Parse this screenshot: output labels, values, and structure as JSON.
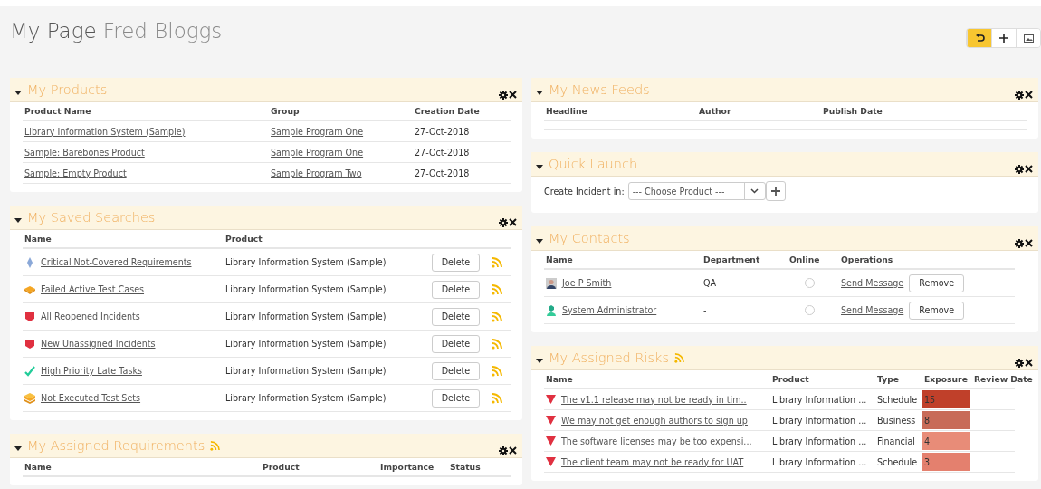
{
  "header": {
    "title": "My Page",
    "user": "Fred Bloggs"
  },
  "toolbar": [
    {
      "kind": "undo",
      "selected": true
    },
    {
      "kind": "add",
      "selected": false
    },
    {
      "kind": "image",
      "selected": false
    }
  ],
  "my_products": {
    "title": "My Products",
    "columns": [
      "Product Name",
      "Group",
      "Creation Date"
    ],
    "rows": [
      {
        "name": "Library Information System (Sample)",
        "group": "Sample Program One",
        "date": "27-Oct-2018"
      },
      {
        "name": "Sample: Barebones Product",
        "group": "Sample Program One",
        "date": "27-Oct-2018"
      },
      {
        "name": "Sample: Empty Product",
        "group": "Sample Program Two",
        "date": "27-Oct-2018"
      }
    ]
  },
  "my_saved_searches": {
    "title": "My Saved Searches",
    "columns": [
      "Name",
      "Product"
    ],
    "rows": [
      {
        "kind": "requirement",
        "name": "Critical Not-Covered Requirements",
        "product": "Library Information System (Sample)",
        "button": "Delete"
      },
      {
        "kind": "testcase",
        "name": "Failed Active Test Cases",
        "product": "Library Information System (Sample)",
        "button": "Delete"
      },
      {
        "kind": "incident",
        "name": "All Reopened Incidents",
        "product": "Library Information System (Sample)",
        "button": "Delete"
      },
      {
        "kind": "incident",
        "name": "New Unassigned Incidents",
        "product": "Library Information System (Sample)",
        "button": "Delete"
      },
      {
        "kind": "task",
        "name": "High Priority Late Tasks",
        "product": "Library Information System (Sample)",
        "button": "Delete"
      },
      {
        "kind": "testset",
        "name": "Not Executed Test Sets",
        "product": "Library Information System (Sample)",
        "button": "Delete"
      }
    ]
  },
  "my_assigned_requirements": {
    "title": "My Assigned Requirements",
    "has_feed": true,
    "columns": [
      "Name",
      "Product",
      "Importance",
      "Status"
    ]
  },
  "my_news_feeds": {
    "title": "My News Feeds",
    "columns": [
      "Headline",
      "Author",
      "Publish Date"
    ]
  },
  "quick_launch": {
    "title": "Quick Launch",
    "label": "Create Incident in:",
    "select": "--- Choose Product ---"
  },
  "my_contacts": {
    "title": "My Contacts",
    "columns": [
      "Name",
      "Department",
      "Online",
      "Operations"
    ],
    "rows": [
      {
        "kind": "person",
        "name": "Joe P Smith",
        "department": "QA",
        "online": false,
        "link": "Send Message",
        "button": "Remove"
      },
      {
        "kind": "admin",
        "name": "System Administrator",
        "department": "-",
        "online": false,
        "link": "Send Message",
        "button": "Remove"
      }
    ]
  },
  "my_assigned_risks": {
    "title": "My Assigned Risks",
    "has_feed": true,
    "columns": [
      "Name",
      "Product",
      "Type",
      "Exposure",
      "Review Date"
    ],
    "rows": [
      {
        "name": "The v1.1 release may not be ready in tim..",
        "product": "Library Information ...",
        "type": "Schedule",
        "exposure": "15",
        "color": "#c0402a"
      },
      {
        "name": "We may not get enough authors to sign up",
        "product": "Library Information ...",
        "type": "Business",
        "exposure": "8",
        "color": "#c86b58"
      },
      {
        "name": "The software licenses may be too expensi...",
        "product": "Library Information ...",
        "type": "Financial",
        "exposure": "4",
        "color": "#e88c78"
      },
      {
        "name": "The client team may not be ready for UAT",
        "product": "Library Information ...",
        "type": "Schedule",
        "exposure": "3",
        "color": "#e4806e"
      }
    ]
  }
}
